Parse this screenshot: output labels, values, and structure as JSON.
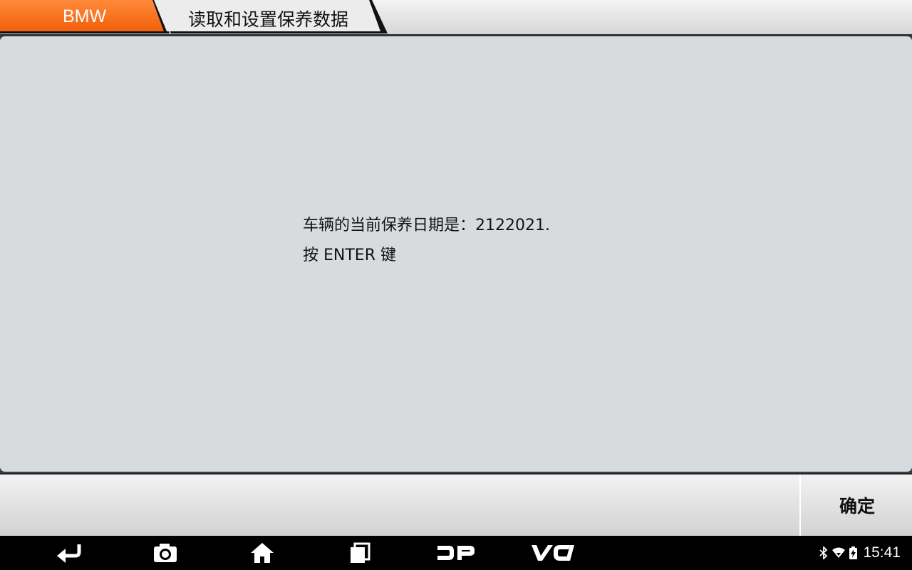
{
  "header": {
    "brand_label": "BMW",
    "page_title": "读取和设置保养数据",
    "brand_color": "#f96a10"
  },
  "content": {
    "message_lines": [
      "车辆的当前保养日期是：2122021.",
      "按 ENTER 键"
    ]
  },
  "actions": {
    "confirm_label": "确定"
  },
  "navbar": {
    "buttons": [
      {
        "name": "back-icon"
      },
      {
        "name": "camera-icon"
      },
      {
        "name": "home-icon"
      },
      {
        "name": "recent-apps-icon"
      },
      {
        "name": "dp-icon"
      },
      {
        "name": "vci-icon"
      }
    ],
    "vci_label": "VCI",
    "dp_label": "DP",
    "status_icons": [
      "bluetooth-icon",
      "wifi-icon",
      "battery-icon"
    ],
    "clock": "15:41"
  }
}
